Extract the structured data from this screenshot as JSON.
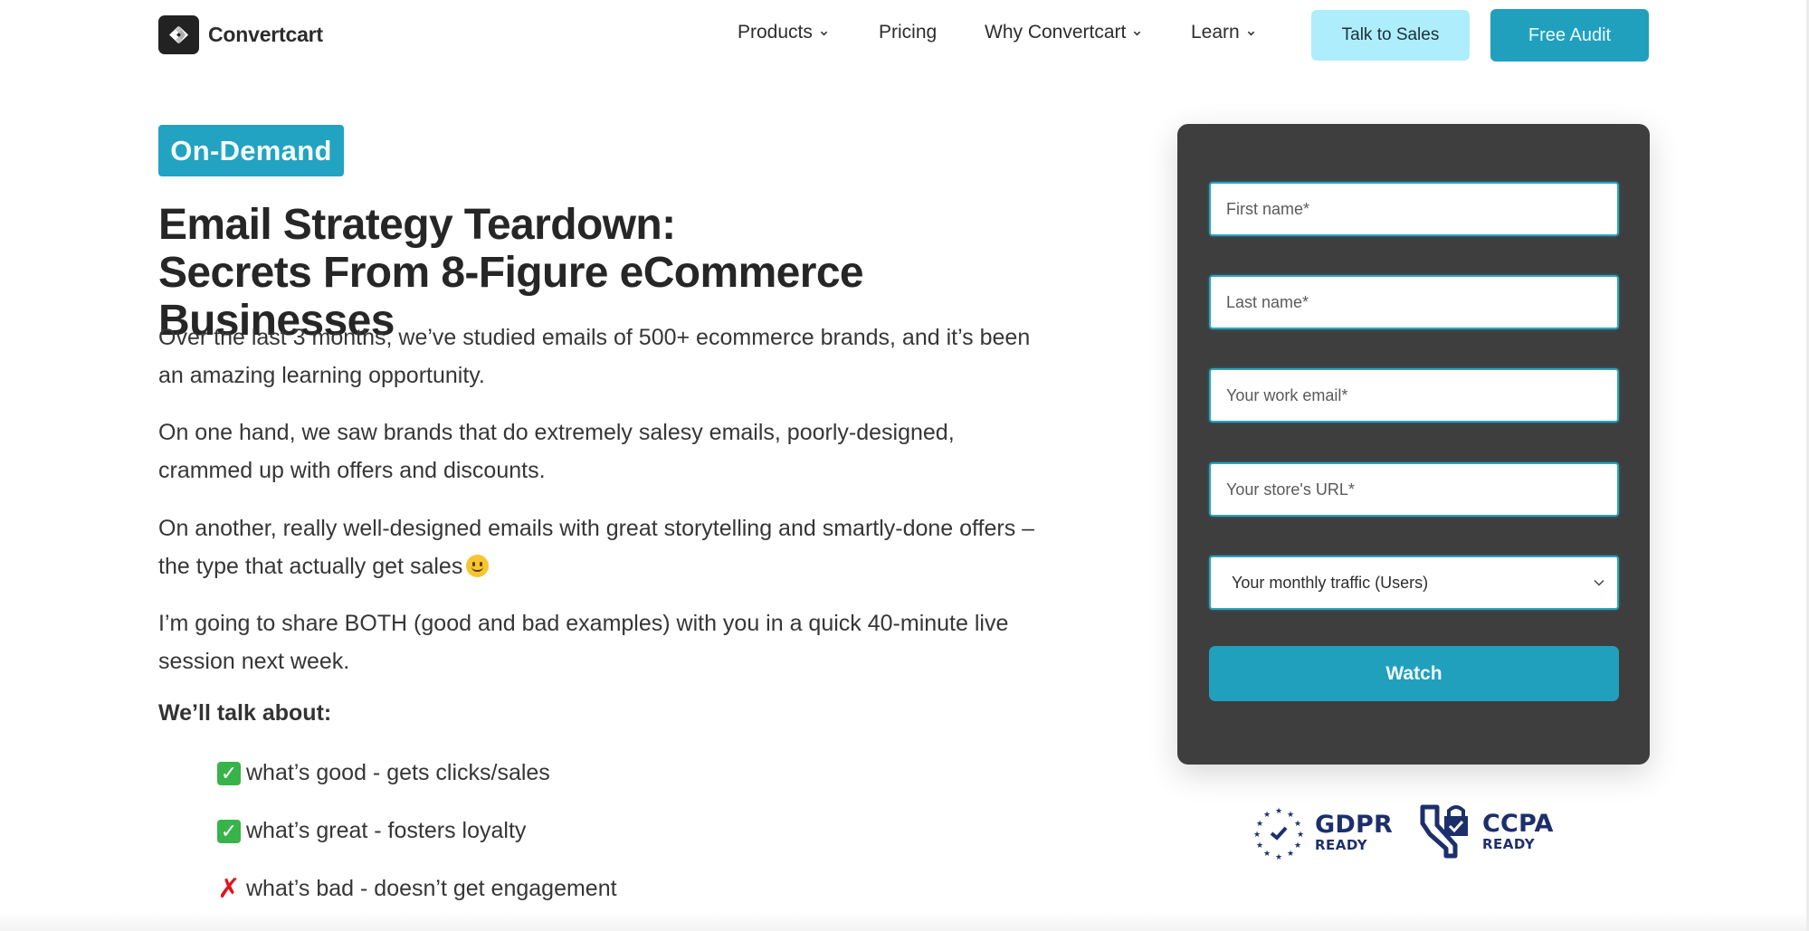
{
  "header": {
    "brand": "Convertcart",
    "nav": [
      {
        "label": "Products",
        "has_dropdown": true
      },
      {
        "label": "Pricing",
        "has_dropdown": false
      },
      {
        "label": "Why Convertcart",
        "has_dropdown": true
      },
      {
        "label": "Learn",
        "has_dropdown": true
      }
    ],
    "talk_to_sales_label": "Talk to Sales",
    "free_audit_label": "Free Audit"
  },
  "hero": {
    "badge": "On-Demand",
    "title_line1": "Email Strategy Teardown:",
    "title_line2": "Secrets From 8-Figure eCommerce Businesses",
    "paragraphs": [
      "Over the last 3 months, we’ve studied emails of 500+ ecommerce brands, and it’s been an amazing learning opportunity.",
      "On one hand, we saw brands that do extremely salesy emails, poorly-designed, crammed up with offers and discounts.",
      "On another, really well-designed emails with great storytelling and smartly-done offers – the type that actually get sales",
      "I’m going to share BOTH (good and bad examples) with you in a quick 40-minute live session next week."
    ],
    "talk_heading": "We’ll talk about:",
    "topics": [
      {
        "icon": "check-mark",
        "text": "what’s good - gets clicks/sales"
      },
      {
        "icon": "check-mark",
        "text": "what’s great - fosters loyalty"
      },
      {
        "icon": "cross-mark",
        "text": "what’s bad - doesn’t get engagement"
      }
    ]
  },
  "form": {
    "first_name_placeholder": "First name*",
    "last_name_placeholder": "Last name*",
    "email_placeholder": "Your work email*",
    "store_url_placeholder": "Your store's URL*",
    "traffic_select_value": "Your monthly traffic (Users)",
    "submit_label": "Watch"
  },
  "compliance": {
    "gdpr_title": "GDPR",
    "gdpr_sub": "READY",
    "ccpa_title": "CCPA",
    "ccpa_sub": "READY"
  },
  "colors": {
    "accent": "#21a0be",
    "accent_light": "#aeeefc",
    "panel_bg": "#3e3e3e",
    "compliance_navy": "#1d2f6b"
  }
}
